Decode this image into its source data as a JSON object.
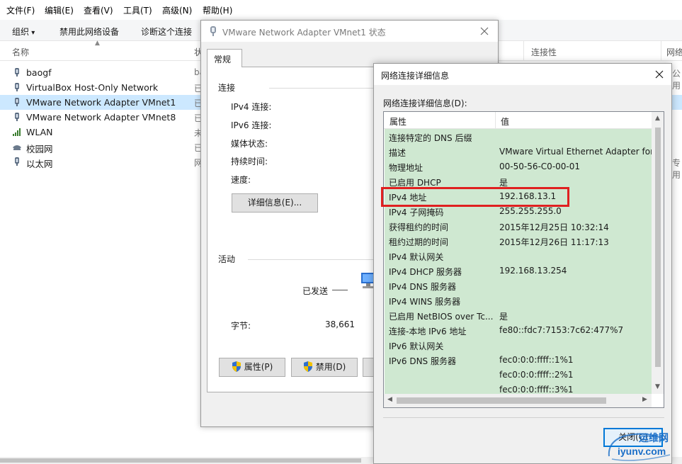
{
  "menubar": {
    "items": [
      "文件(F)",
      "编辑(E)",
      "查看(V)",
      "工具(T)",
      "高级(N)",
      "帮助(H)"
    ]
  },
  "toolbar": {
    "organize": "组织",
    "disable_device": "禁用此网络设备",
    "diagnose": "诊断这个连接"
  },
  "columns": {
    "name": "名称",
    "status": "状",
    "connectivity": "连接性",
    "network": "网络"
  },
  "networks": [
    {
      "name": "baogf",
      "status": "ba",
      "icon": "network-adapter-icon"
    },
    {
      "name": "VirtualBox Host-Only Network",
      "status": "已",
      "icon": "network-adapter-icon"
    },
    {
      "name": "VMware Network Adapter VMnet1",
      "status": "已",
      "icon": "network-adapter-icon",
      "selected": true
    },
    {
      "name": "VMware Network Adapter VMnet8",
      "status": "已",
      "icon": "network-adapter-icon"
    },
    {
      "name": "WLAN",
      "status": "未",
      "icon": "wifi-signal-icon"
    },
    {
      "name": "校园网",
      "status": "已",
      "icon": "dialup-icon"
    },
    {
      "name": "以太网",
      "status": "网",
      "icon": "network-adapter-icon"
    }
  ],
  "right_col_fragments": [
    "公用",
    "专用"
  ],
  "status_dialog": {
    "title": "VMware Network Adapter VMnet1 状态",
    "tab": "常规",
    "connection_group": "连接",
    "fields": [
      "IPv4 连接:",
      "IPv6 连接:",
      "媒体状态:",
      "持续时间:",
      "速度:"
    ],
    "details_button": "详细信息(E)...",
    "activity_group": "活动",
    "sent_label": "已发送",
    "bytes_label": "字节:",
    "bytes_sent": "38,661",
    "properties_button": "属性(P)",
    "disable_button": "禁用(D)"
  },
  "details_dialog": {
    "title": "网络连接详细信息",
    "subtitle": "网络连接详细信息(D):",
    "col_property": "属性",
    "col_value": "值",
    "rows": [
      {
        "name": "连接特定的 DNS 后缀",
        "value": ""
      },
      {
        "name": "描述",
        "value": "VMware Virtual Ethernet Adapter for"
      },
      {
        "name": "物理地址",
        "value": "00-50-56-C0-00-01"
      },
      {
        "name": "已启用 DHCP",
        "value": "是"
      },
      {
        "name": "IPv4 地址",
        "value": "192.168.13.1"
      },
      {
        "name": "IPv4 子网掩码",
        "value": "255.255.255.0"
      },
      {
        "name": "获得租约的时间",
        "value": "2015年12月25日 10:32:14"
      },
      {
        "name": "租约过期的时间",
        "value": "2015年12月26日 11:17:13"
      },
      {
        "name": "IPv4 默认网关",
        "value": ""
      },
      {
        "name": "IPv4 DHCP 服务器",
        "value": "192.168.13.254"
      },
      {
        "name": "IPv4 DNS 服务器",
        "value": ""
      },
      {
        "name": "IPv4 WINS 服务器",
        "value": ""
      },
      {
        "name": "已启用 NetBIOS over Tc...",
        "value": "是"
      },
      {
        "name": "连接-本地 IPv6 地址",
        "value": "fe80::fdc7:7153:7c62:477%7"
      },
      {
        "name": "IPv6 默认网关",
        "value": ""
      },
      {
        "name": "IPv6 DNS 服务器",
        "value": "fec0:0:0:ffff::1%1"
      },
      {
        "name": "",
        "value": "fec0:0:0:ffff::2%1"
      },
      {
        "name": "",
        "value": "fec0:0:0:ffff::3%1"
      }
    ],
    "close_button": "关闭(C)"
  },
  "watermark": {
    "text": "iyunv.com",
    "brand_text": "运维网"
  },
  "colors": {
    "list_green": "#cfe8d1",
    "selection_blue": "#cce8ff",
    "highlight_red": "#e02020",
    "accent_blue": "#0078d7"
  }
}
